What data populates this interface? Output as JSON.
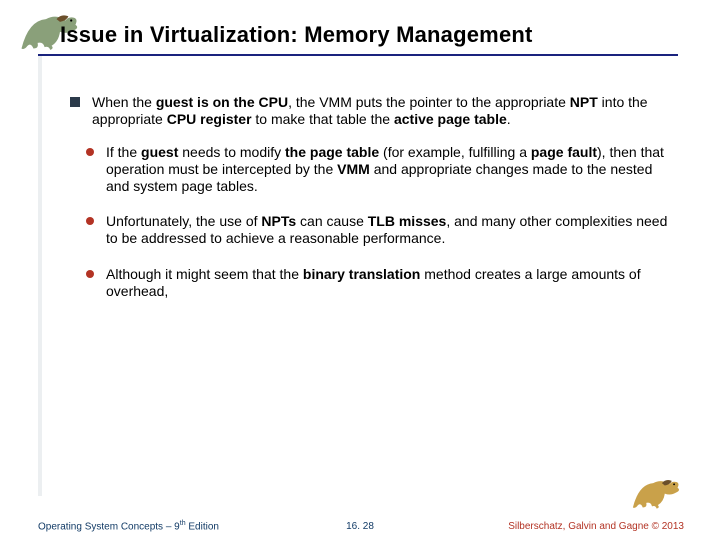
{
  "title": "Issue in Virtualization: Memory Management",
  "bullets": {
    "b0": "When the <b>guest is on the CPU</b>, the VMM puts the pointer to the appropriate <b>NPT</b> into the appropriate <b>CPU register</b> to make that table the <b>active page table</b>.",
    "b1": "If the <b>guest</b> needs to modify <b>the page table</b> (for example, fulfilling a <b>page fault</b>), then that operation must be intercepted by the <b>VMM</b> and appropriate changes made to the nested and system page tables.",
    "b2": "Unfortunately, the use of <b>NPTs</b> can cause <b>TLB misses</b>, and many other complexities need to be addressed to achieve a reasonable performance.",
    "b3": "Although it might seem that the <b>binary translation</b> method creates a large amounts of overhead,"
  },
  "footer": {
    "left_pre": "Operating System Concepts – 9",
    "left_sup": "th",
    "left_post": " Edition",
    "center": "16. 28",
    "right": "Silberschatz, Galvin and Gagne © 2013"
  }
}
